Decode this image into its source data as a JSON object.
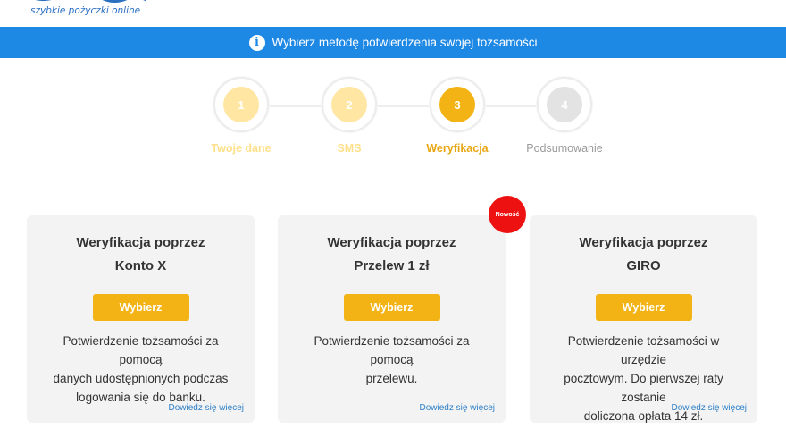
{
  "logo": {
    "tagline": "szybkie pożyczki online"
  },
  "banner": {
    "icon": "info-icon",
    "text": "Wybierz metodę potwierdzenia swojej tożsamości"
  },
  "stepper": {
    "steps": [
      {
        "number": "1",
        "label": "Twoje dane",
        "state": "done"
      },
      {
        "number": "2",
        "label": "SMS",
        "state": "done"
      },
      {
        "number": "3",
        "label": "Weryfikacja",
        "state": "active"
      },
      {
        "number": "4",
        "label": "Podsumowanie",
        "state": "future"
      }
    ]
  },
  "cards": [
    {
      "title_line1": "Weryfikacja poprzez",
      "title_line2": "Konto X",
      "button": "Wybierz",
      "desc_lines": [
        "Potwierdzenie tożsamości za pomocą",
        "danych udostępnionych podczas",
        "logowania się do banku."
      ],
      "more": "Dowiedz się więcej"
    },
    {
      "title_line1": "Weryfikacja poprzez",
      "title_line2": "Przelew 1 zł",
      "button": "Wybierz",
      "desc_lines": [
        "Potwierdzenie tożsamości za pomocą",
        "przelewu."
      ],
      "more": "Dowiedz się więcej",
      "badge": "Nowość"
    },
    {
      "title_line1": "Weryfikacja poprzez",
      "title_line2": "GIRO",
      "button": "Wybierz",
      "desc_lines": [
        "Potwierdzenie tożsamości w urzędzie",
        "pocztowym. Do pierwszej raty zostanie",
        "doliczona opłata 14 zł."
      ],
      "more": "Dowiedz się więcej"
    }
  ],
  "colors": {
    "banner": "#1e88e5",
    "accent": "#f3b315",
    "badge": "#ee1111",
    "card_bg": "#f3f3f3",
    "link": "#2f80c8"
  }
}
